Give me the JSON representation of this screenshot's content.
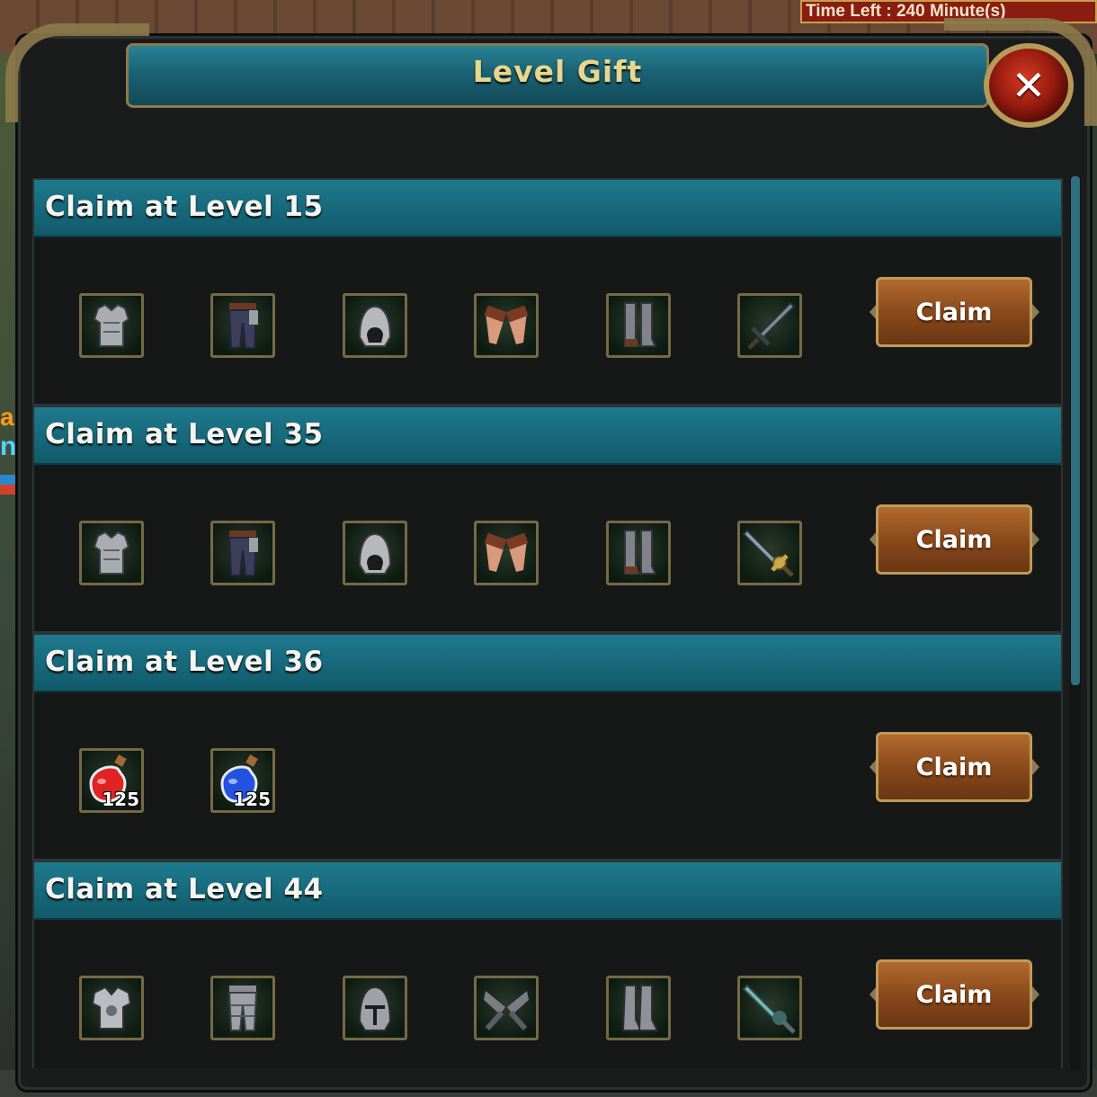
{
  "timer": {
    "text": "Time Left : 240 Minute(s)"
  },
  "side": {
    "letter_a": "a",
    "letter_n": "n"
  },
  "window": {
    "title": "Level Gift"
  },
  "colors": {
    "header": "#1a6d80",
    "claim": "#8a4a1c",
    "border_gold": "#756a44",
    "title_text": "#e6d78c"
  },
  "sections": [
    {
      "title": "Claim at Level 15",
      "claim_label": "Claim",
      "items": [
        {
          "icon": "chest-armor-icon"
        },
        {
          "icon": "pants-icon"
        },
        {
          "icon": "helmet-icon"
        },
        {
          "icon": "gloves-icon"
        },
        {
          "icon": "boots-icon"
        },
        {
          "icon": "sword-icon"
        }
      ]
    },
    {
      "title": "Claim at Level 35",
      "claim_label": "Claim",
      "items": [
        {
          "icon": "chest-armor-icon"
        },
        {
          "icon": "pants-icon"
        },
        {
          "icon": "helmet-icon"
        },
        {
          "icon": "gloves-icon"
        },
        {
          "icon": "boots-icon"
        },
        {
          "icon": "golden-sword-icon"
        }
      ]
    },
    {
      "title": "Claim at Level 36",
      "claim_label": "Claim",
      "items": [
        {
          "icon": "red-potion-icon",
          "qty": "125"
        },
        {
          "icon": "blue-potion-icon",
          "qty": "125"
        }
      ]
    },
    {
      "title": "Claim at Level 44",
      "claim_label": "Claim",
      "items": [
        {
          "icon": "plate-armor-icon"
        },
        {
          "icon": "plate-pants-icon"
        },
        {
          "icon": "knight-helmet-icon"
        },
        {
          "icon": "plate-gloves-icon"
        },
        {
          "icon": "plate-boots-icon"
        },
        {
          "icon": "spirit-sword-icon"
        }
      ]
    }
  ]
}
